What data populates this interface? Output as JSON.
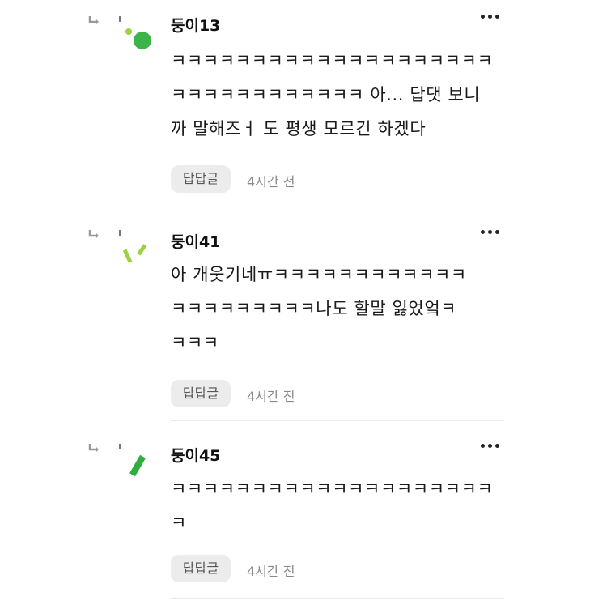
{
  "comments": [
    {
      "username": "둥이13",
      "text": "ㅋㅋㅋㅋㅋㅋㅋㅋㅋㅋㅋㅋㅋㅋㅋㅋㅋㅋㅋㅋ\nㅋㅋㅋㅋㅋㅋㅋㅋㅋㅋㅋㅋ 아... 답댓 보니\n까 말해즈ㅓ 도 평생 모르긴 하겠다",
      "reply_label": "답답글",
      "time": "4시간 전"
    },
    {
      "username": "둥이41",
      "text": "아 개웃기네ㅠㅋㅋㅋㅋㅋㅋㅋㅋㅋㅋㅋㅋ\nㅋㅋㅋㅋㅋㅋㅋㅋㅋ나도 할말 잃었엌ㅋ\nㅋㅋㅋ",
      "reply_label": "답답글",
      "time": "4시간 전"
    },
    {
      "username": "둥이45",
      "text": "ㅋㅋㅋㅋㅋㅋㅋㅋㅋㅋㅋㅋㅋㅋㅋㅋㅋㅋㅋㅋ\nㅋ",
      "reply_label": "답답글",
      "time": "4시간 전"
    }
  ],
  "colors": {
    "avatar_green_dark": "#3cb44a",
    "avatar_green_light": "#9bd142",
    "avatar_green_medium": "#2fae3f"
  },
  "icons": {
    "reply_indicator": "reply-arrow-icon",
    "more_menu": "more-vertical-dots-icon"
  }
}
